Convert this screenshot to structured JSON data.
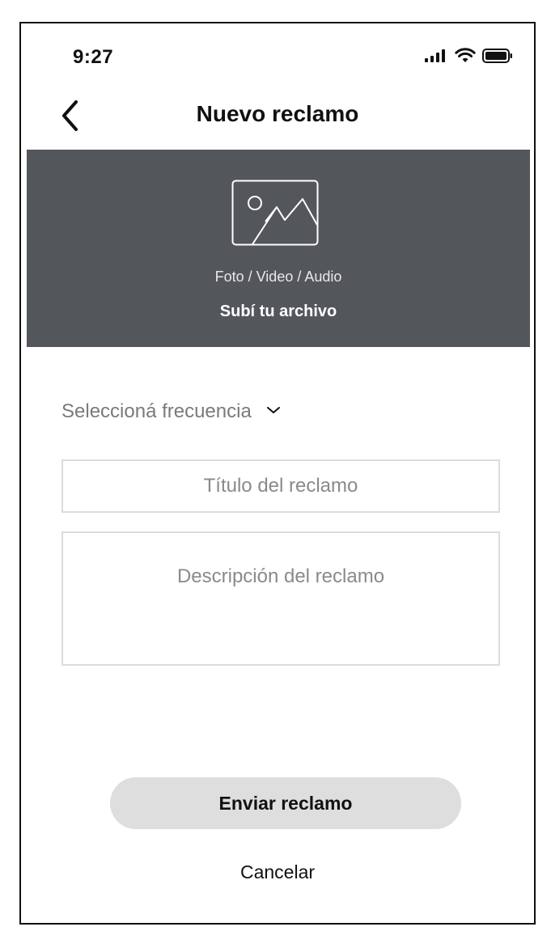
{
  "status_bar": {
    "time": "9:27",
    "icons": [
      "cellular-signal-icon",
      "wifi-icon",
      "battery-icon"
    ]
  },
  "nav": {
    "back_icon": "chevron-left-icon",
    "title": "Nuevo reclamo"
  },
  "upload": {
    "icon": "image-placeholder-icon",
    "caption": "Foto / Video / Audio",
    "cta": "Subí tu archivo",
    "background_color": "#53565b"
  },
  "form": {
    "frequency": {
      "label": "Seleccioná frecuencia",
      "icon": "chevron-down-icon"
    },
    "title_field": {
      "placeholder": "Título del reclamo",
      "value": ""
    },
    "description_field": {
      "placeholder": "Descripción del reclamo",
      "value": ""
    }
  },
  "actions": {
    "submit_label": "Enviar reclamo",
    "cancel_label": "Cancelar",
    "submit_background": "#dedede"
  }
}
